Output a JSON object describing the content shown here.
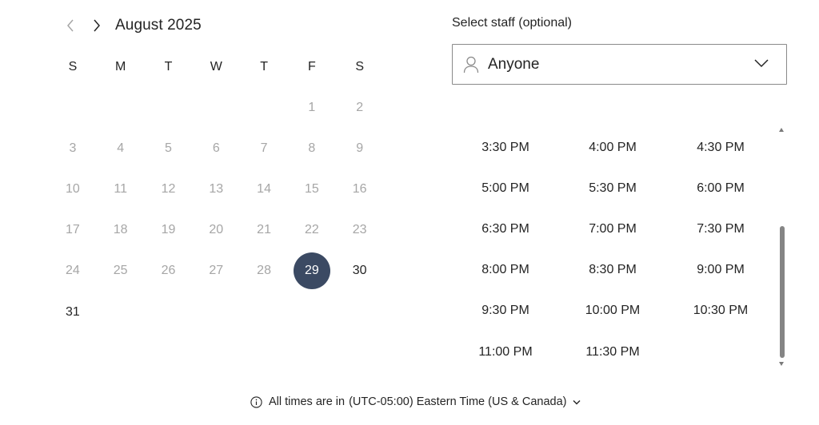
{
  "calendar": {
    "month_label": "August 2025",
    "prev_icon": "chevron-left-icon",
    "next_icon": "chevron-right-icon",
    "weekdays": [
      "S",
      "M",
      "T",
      "W",
      "T",
      "F",
      "S"
    ],
    "weeks": [
      [
        "",
        "",
        "",
        "",
        "",
        "1",
        "2"
      ],
      [
        "3",
        "4",
        "5",
        "6",
        "7",
        "8",
        "9"
      ],
      [
        "10",
        "11",
        "12",
        "13",
        "14",
        "15",
        "16"
      ],
      [
        "17",
        "18",
        "19",
        "20",
        "21",
        "22",
        "23"
      ],
      [
        "24",
        "25",
        "26",
        "27",
        "28",
        "29",
        "30"
      ],
      [
        "31",
        "",
        "",
        "",
        "",
        "",
        ""
      ]
    ],
    "selected_day": "29",
    "available_days": [
      "29",
      "30",
      "31"
    ]
  },
  "staff": {
    "label": "Select staff (optional)",
    "value": "Anyone",
    "icon": "person-icon",
    "dropdown_icon": "chevron-down-icon"
  },
  "time_slots": [
    "3:30 PM",
    "4:00 PM",
    "4:30 PM",
    "5:00 PM",
    "5:30 PM",
    "6:00 PM",
    "6:30 PM",
    "7:00 PM",
    "7:30 PM",
    "8:00 PM",
    "8:30 PM",
    "9:00 PM",
    "9:30 PM",
    "10:00 PM",
    "10:30 PM",
    "11:00 PM",
    "11:30 PM"
  ],
  "timezone": {
    "prefix": "All times are in",
    "zone": "(UTC-05:00) Eastern Time (US & Canada)",
    "icon": "info-icon",
    "dropdown_icon": "chevron-down-icon"
  },
  "colors": {
    "selected_day_bg": "#3b4a63",
    "disabled_text": "#a6a6a6",
    "text": "#242424",
    "border": "#8a8a8a"
  }
}
